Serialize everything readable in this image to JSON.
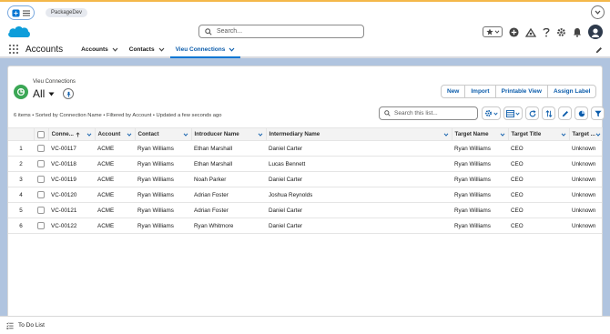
{
  "top_strip": {
    "tab_label": "PackageDev"
  },
  "header": {
    "search_placeholder": "Search...",
    "brand_color": "#0176d3"
  },
  "nav": {
    "app_name": "Accounts",
    "items": [
      {
        "label": "Accounts"
      },
      {
        "label": "Contacts"
      },
      {
        "label": "Vieu Connections"
      }
    ]
  },
  "list_view": {
    "object_label": "Vieu Connections",
    "view_name": "All",
    "buttons": [
      "New",
      "Import",
      "Printable View",
      "Assign Label"
    ],
    "summary": "6 items • Sorted by Connection Name • Filtered by Account • Updated a few seconds ago",
    "search_placeholder": "Search this list..."
  },
  "table": {
    "columns": [
      "Conne...",
      "Account",
      "Contact",
      "Introducer Name",
      "Intermediary Name",
      "Target Name",
      "Target Title",
      "Target ..."
    ],
    "rows": [
      {
        "num": "1",
        "conn": "VC-00117",
        "account": "ACME",
        "contact": "Ryan Williams",
        "introducer": "Ethan Marshall",
        "intermediary": "Daniel Carter",
        "target_name": "Ryan Williams",
        "target_title": "CEO",
        "target_x": "Unknown"
      },
      {
        "num": "2",
        "conn": "VC-00118",
        "account": "ACME",
        "contact": "Ryan Williams",
        "introducer": "Ethan Marshall",
        "intermediary": "Lucas Bennett",
        "target_name": "Ryan Williams",
        "target_title": "CEO",
        "target_x": "Unknown"
      },
      {
        "num": "3",
        "conn": "VC-00119",
        "account": "ACME",
        "contact": "Ryan Williams",
        "introducer": "Noah Parker",
        "intermediary": "Daniel Carter",
        "target_name": "Ryan Williams",
        "target_title": "CEO",
        "target_x": "Unknown"
      },
      {
        "num": "4",
        "conn": "VC-00120",
        "account": "ACME",
        "contact": "Ryan Williams",
        "introducer": "Adrian Foster",
        "intermediary": "Joshua Reynolds",
        "target_name": "Ryan Williams",
        "target_title": "CEO",
        "target_x": "Unknown"
      },
      {
        "num": "5",
        "conn": "VC-00121",
        "account": "ACME",
        "contact": "Ryan Williams",
        "introducer": "Adrian Foster",
        "intermediary": "Daniel Carter",
        "target_name": "Ryan Williams",
        "target_title": "CEO",
        "target_x": "Unknown"
      },
      {
        "num": "6",
        "conn": "VC-00122",
        "account": "ACME",
        "contact": "Ryan Williams",
        "introducer": "Ryan Whitmore",
        "intermediary": "Daniel Carter",
        "target_name": "Ryan Williams",
        "target_title": "CEO",
        "target_x": "Unknown"
      }
    ]
  },
  "utility_bar": {
    "label": "To Do List"
  }
}
